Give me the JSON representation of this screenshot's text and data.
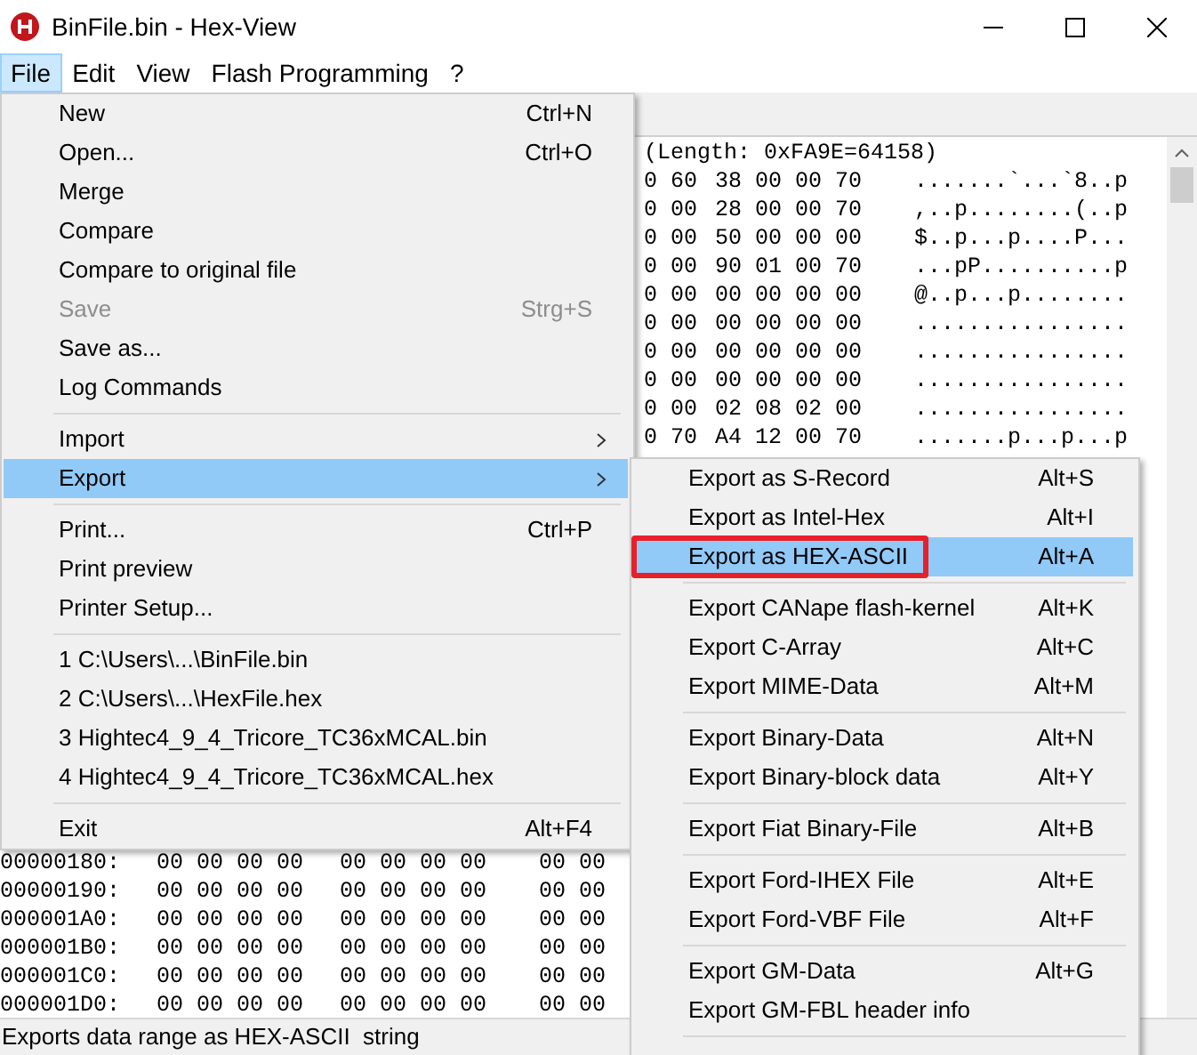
{
  "window": {
    "title": "BinFile.bin - Hex-View"
  },
  "menu_bar": [
    {
      "label": "File",
      "selected": true
    },
    {
      "label": "Edit",
      "selected": false
    },
    {
      "label": "View",
      "selected": false
    },
    {
      "label": "Flash Programming",
      "selected": false
    },
    {
      "label": "?",
      "selected": false
    }
  ],
  "hex_view": {
    "header": "(Length: 0xFA9E=64158)",
    "top_rows": [
      {
        "group_1": "0 60",
        "group_2": "38 00 00 70",
        "ascii": ".......`...`8..p"
      },
      {
        "group_1": "0 00",
        "group_2": "28 00 00 70",
        "ascii": ",..p........(..p"
      },
      {
        "group_1": "0 00",
        "group_2": "50 00 00 00",
        "ascii": "$..p...p....P..."
      },
      {
        "group_1": "0 00",
        "group_2": "90 01 00 70",
        "ascii": "...pP..........p"
      },
      {
        "group_1": "0 00",
        "group_2": "00 00 00 00",
        "ascii": "@..p...p........"
      },
      {
        "group_1": "0 00",
        "group_2": "00 00 00 00",
        "ascii": "................"
      },
      {
        "group_1": "0 00",
        "group_2": "00 00 00 00",
        "ascii": "................"
      },
      {
        "group_1": "0 00",
        "group_2": "00 00 00 00",
        "ascii": "................"
      },
      {
        "group_1": "0 00",
        "group_2": "02 08 02 00",
        "ascii": "................"
      },
      {
        "group_1": "0 70",
        "group_2": "A4 12 00 70",
        "ascii": ".......p...p...p"
      }
    ],
    "bottom_rows": [
      {
        "address": "00000180:",
        "group_1": "00 00 00 00",
        "group_2": "00 00 00 00",
        "group_3": "00 00"
      },
      {
        "address": "00000190:",
        "group_1": "00 00 00 00",
        "group_2": "00 00 00 00",
        "group_3": "00 00"
      },
      {
        "address": "000001A0:",
        "group_1": "00 00 00 00",
        "group_2": "00 00 00 00",
        "group_3": "00 00"
      },
      {
        "address": "000001B0:",
        "group_1": "00 00 00 00",
        "group_2": "00 00 00 00",
        "group_3": "00 00"
      },
      {
        "address": "000001C0:",
        "group_1": "00 00 00 00",
        "group_2": "00 00 00 00",
        "group_3": "00 00"
      },
      {
        "address": "000001D0:",
        "group_1": "00 00 00 00",
        "group_2": "00 00 00 00",
        "group_3": "00 00"
      }
    ]
  },
  "file_menu": [
    {
      "kind": "item",
      "label": "New",
      "shortcut": "Ctrl+N",
      "disabled": false,
      "selected": false
    },
    {
      "kind": "item",
      "label": "Open...",
      "shortcut": "Ctrl+O",
      "disabled": false,
      "selected": false
    },
    {
      "kind": "item",
      "label": "Merge",
      "disabled": false,
      "selected": false
    },
    {
      "kind": "item",
      "label": "Compare",
      "disabled": false,
      "selected": false
    },
    {
      "kind": "item",
      "label": "Compare to original file",
      "disabled": false,
      "selected": false
    },
    {
      "kind": "item",
      "label": "Save",
      "shortcut": "Strg+S",
      "disabled": true,
      "selected": false
    },
    {
      "kind": "item",
      "label": "Save as...",
      "disabled": false,
      "selected": false
    },
    {
      "kind": "item",
      "label": "Log Commands",
      "disabled": false,
      "selected": false
    },
    {
      "kind": "separator"
    },
    {
      "kind": "submenu",
      "label": "Import",
      "disabled": false,
      "selected": false
    },
    {
      "kind": "submenu",
      "label": "Export",
      "disabled": false,
      "selected": true
    },
    {
      "kind": "separator"
    },
    {
      "kind": "item",
      "label": "Print...",
      "shortcut": "Ctrl+P",
      "disabled": false,
      "selected": false
    },
    {
      "kind": "item",
      "label": "Print preview",
      "disabled": false,
      "selected": false
    },
    {
      "kind": "item",
      "label": "Printer Setup...",
      "disabled": false,
      "selected": false
    },
    {
      "kind": "separator"
    },
    {
      "kind": "item",
      "label": "1 C:\\Users\\...\\BinFile.bin",
      "disabled": false,
      "selected": false
    },
    {
      "kind": "item",
      "label": "2 C:\\Users\\...\\HexFile.hex",
      "disabled": false,
      "selected": false
    },
    {
      "kind": "item",
      "label": "3 Hightec4_9_4_Tricore_TC36xMCAL.bin",
      "disabled": false,
      "selected": false
    },
    {
      "kind": "item",
      "label": "4 Hightec4_9_4_Tricore_TC36xMCAL.hex",
      "disabled": false,
      "selected": false
    },
    {
      "kind": "separator"
    },
    {
      "kind": "item",
      "label": "Exit",
      "shortcut": "Alt+F4",
      "disabled": false,
      "selected": false
    }
  ],
  "export_menu": [
    {
      "kind": "item",
      "label": "Export as S-Record",
      "shortcut": "Alt+S",
      "selected": false,
      "outlined": false
    },
    {
      "kind": "item",
      "label": "Export as Intel-Hex",
      "shortcut": "Alt+I",
      "selected": false,
      "outlined": false
    },
    {
      "kind": "item",
      "label": "Export as HEX-ASCII",
      "shortcut": "Alt+A",
      "selected": true,
      "outlined": true
    },
    {
      "kind": "separator"
    },
    {
      "kind": "item",
      "label": "Export CANape flash-kernel",
      "shortcut": "Alt+K",
      "selected": false,
      "outlined": false
    },
    {
      "kind": "item",
      "label": "Export C-Array",
      "shortcut": "Alt+C",
      "selected": false,
      "outlined": false
    },
    {
      "kind": "item",
      "label": "Export MIME-Data",
      "shortcut": "Alt+M",
      "selected": false,
      "outlined": false
    },
    {
      "kind": "separator"
    },
    {
      "kind": "item",
      "label": "Export Binary-Data",
      "shortcut": "Alt+N",
      "selected": false,
      "outlined": false
    },
    {
      "kind": "item",
      "label": "Export Binary-block data",
      "shortcut": "Alt+Y",
      "selected": false,
      "outlined": false
    },
    {
      "kind": "separator"
    },
    {
      "kind": "item",
      "label": "Export Fiat Binary-File",
      "shortcut": "Alt+B",
      "selected": false,
      "outlined": false
    },
    {
      "kind": "separator"
    },
    {
      "kind": "item",
      "label": "Export Ford-IHEX File",
      "shortcut": "Alt+E",
      "selected": false,
      "outlined": false
    },
    {
      "kind": "item",
      "label": "Export Ford-VBF File",
      "shortcut": "Alt+F",
      "selected": false,
      "outlined": false
    },
    {
      "kind": "separator"
    },
    {
      "kind": "item",
      "label": "Export GM-Data",
      "shortcut": "Alt+G",
      "selected": false,
      "outlined": false
    },
    {
      "kind": "item",
      "label": "Export GM-FBL header info",
      "selected": false,
      "outlined": false
    },
    {
      "kind": "separator"
    }
  ],
  "status_bar": {
    "text": "Exports data range as HEX-ASCII  string"
  }
}
